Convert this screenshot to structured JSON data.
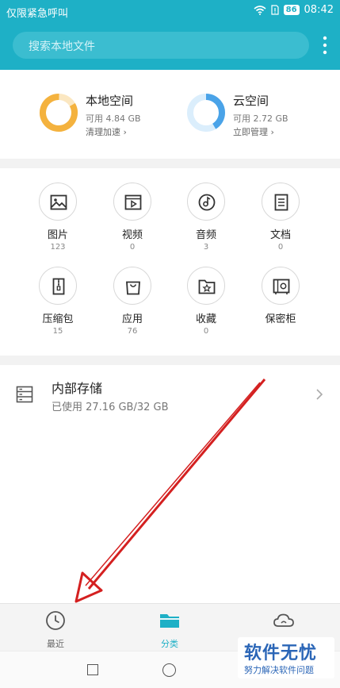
{
  "status_bar": {
    "carrier": "仅限紧急呼叫",
    "battery": "86",
    "time": "08:42"
  },
  "header": {
    "search_placeholder": "搜索本地文件",
    "accent": "#1eb0c6"
  },
  "storage": {
    "local": {
      "title": "本地空间",
      "available": "可用 4.84 GB",
      "action": "清理加速",
      "ring_color": "#f4b23e"
    },
    "cloud": {
      "title": "云空间",
      "available": "可用 2.72 GB",
      "action": "立即管理",
      "ring_color": "#4aa3e8"
    }
  },
  "categories": [
    {
      "label": "图片",
      "count": "123",
      "icon": "image-icon"
    },
    {
      "label": "视频",
      "count": "0",
      "icon": "video-icon"
    },
    {
      "label": "音频",
      "count": "3",
      "icon": "audio-icon"
    },
    {
      "label": "文档",
      "count": "0",
      "icon": "document-icon"
    },
    {
      "label": "压缩包",
      "count": "15",
      "icon": "archive-icon"
    },
    {
      "label": "应用",
      "count": "76",
      "icon": "app-bag-icon"
    },
    {
      "label": "收藏",
      "count": "0",
      "icon": "favorite-folder-icon"
    },
    {
      "label": "保密柜",
      "count": "",
      "icon": "safe-icon"
    }
  ],
  "internal_storage": {
    "name": "内部存储",
    "usage": "已使用 27.16 GB/32 GB"
  },
  "tabs": {
    "recent": "最近",
    "category": "分类",
    "active": "category"
  },
  "watermark": {
    "main": "软件无忧",
    "sub": "努力解决软件问题"
  }
}
